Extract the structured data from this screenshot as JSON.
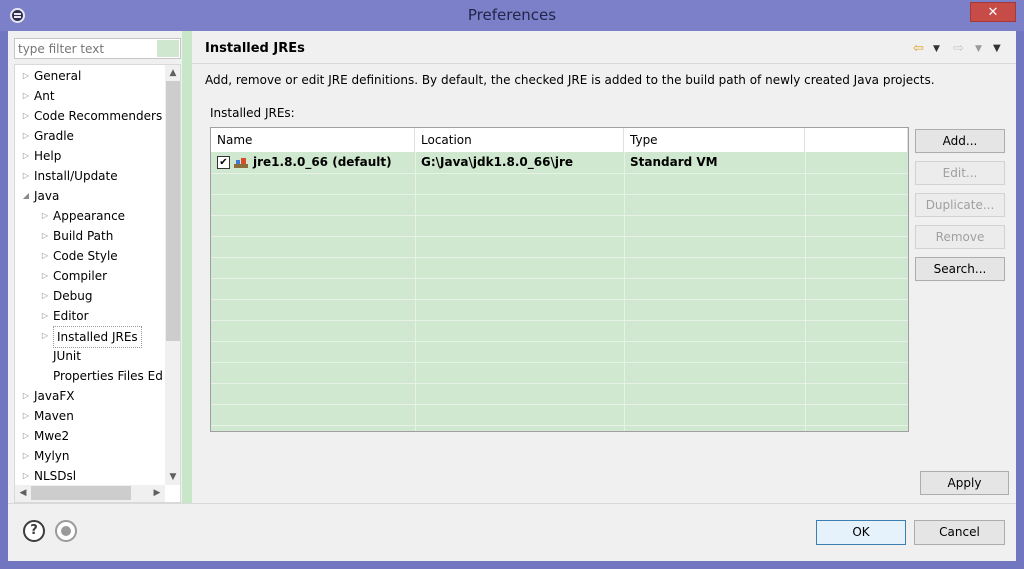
{
  "window": {
    "title": "Preferences",
    "minimize_glyph": "—",
    "close_glyph": "✕"
  },
  "filter": {
    "placeholder": "type filter text"
  },
  "tree": {
    "items": [
      {
        "label": "General",
        "expandable": true,
        "depth": 0
      },
      {
        "label": "Ant",
        "expandable": true,
        "depth": 0
      },
      {
        "label": "Code Recommenders",
        "expandable": true,
        "depth": 0
      },
      {
        "label": "Gradle",
        "expandable": true,
        "depth": 0
      },
      {
        "label": "Help",
        "expandable": true,
        "depth": 0
      },
      {
        "label": "Install/Update",
        "expandable": true,
        "depth": 0
      },
      {
        "label": "Java",
        "expandable": true,
        "expanded": true,
        "depth": 0
      },
      {
        "label": "Appearance",
        "expandable": true,
        "depth": 1
      },
      {
        "label": "Build Path",
        "expandable": true,
        "depth": 1
      },
      {
        "label": "Code Style",
        "expandable": true,
        "depth": 1
      },
      {
        "label": "Compiler",
        "expandable": true,
        "depth": 1
      },
      {
        "label": "Debug",
        "expandable": true,
        "depth": 1
      },
      {
        "label": "Editor",
        "expandable": true,
        "depth": 1
      },
      {
        "label": "Installed JREs",
        "expandable": true,
        "depth": 1,
        "selected": true
      },
      {
        "label": "JUnit",
        "expandable": false,
        "depth": 1
      },
      {
        "label": "Properties Files Ed",
        "expandable": false,
        "depth": 1
      },
      {
        "label": "JavaFX",
        "expandable": true,
        "depth": 0
      },
      {
        "label": "Maven",
        "expandable": true,
        "depth": 0
      },
      {
        "label": "Mwe2",
        "expandable": true,
        "depth": 0
      },
      {
        "label": "Mylyn",
        "expandable": true,
        "depth": 0
      },
      {
        "label": "NLSDsl",
        "expandable": true,
        "depth": 0
      }
    ]
  },
  "page": {
    "title": "Installed JREs",
    "description": "Add, remove or edit JRE definitions. By default, the checked JRE is added to the build path of newly created Java projects.",
    "list_label": "Installed JREs:"
  },
  "table": {
    "columns": [
      "Name",
      "Location",
      "Type"
    ],
    "rows": [
      {
        "checked": true,
        "name": "jre1.8.0_66 (default)",
        "location": "G:\\Java\\jdk1.8.0_66\\jre",
        "type": "Standard VM"
      }
    ]
  },
  "side_buttons": {
    "add": "Add...",
    "edit": "Edit...",
    "duplicate": "Duplicate...",
    "remove": "Remove",
    "search": "Search..."
  },
  "apply_label": "Apply",
  "ok_label": "OK",
  "cancel_label": "Cancel",
  "help_glyph": "?",
  "check_glyph": "✔",
  "colors": {
    "title_bar": "#7b80c8",
    "close_button": "#c74b47",
    "selection_green": "#cfe8cf",
    "nav_arrow": "#e0a020"
  }
}
